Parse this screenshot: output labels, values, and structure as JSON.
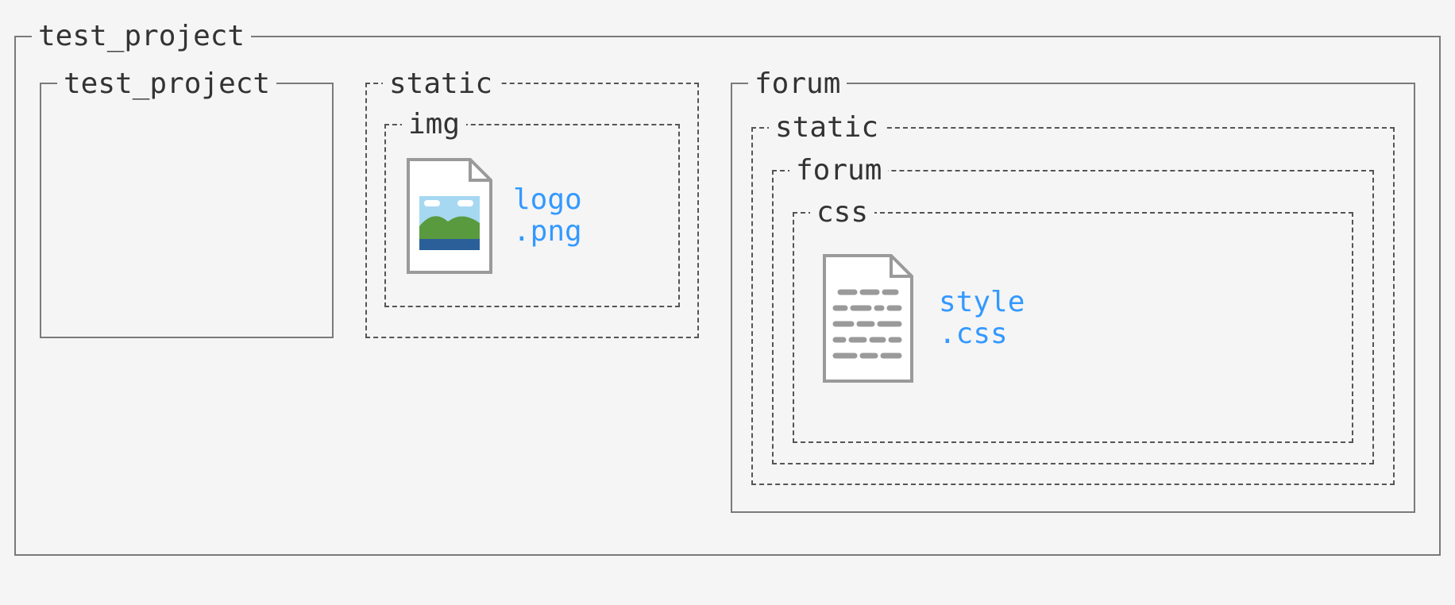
{
  "root": {
    "label": "test_project",
    "children": {
      "inner_project": {
        "label": "test_project"
      },
      "static": {
        "label": "static",
        "img": {
          "label": "img",
          "file": "logo\n.png"
        }
      },
      "forum": {
        "label": "forum",
        "static": {
          "label": "static",
          "forum": {
            "label": "forum",
            "css": {
              "label": "css",
              "file": "style\n.css"
            }
          }
        }
      }
    }
  }
}
